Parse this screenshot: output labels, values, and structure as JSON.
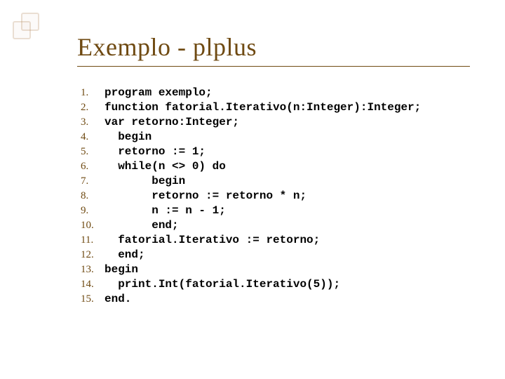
{
  "slide": {
    "title": "Exemplo - plplus"
  },
  "code": {
    "lines": [
      {
        "n": "1.",
        "text": "program exemplo;"
      },
      {
        "n": "2.",
        "text": "function fatorial.Iterativo(n:Integer):Integer;"
      },
      {
        "n": "3.",
        "text": "var retorno:Integer;"
      },
      {
        "n": "4.",
        "text": "  begin"
      },
      {
        "n": "5.",
        "text": "  retorno := 1;"
      },
      {
        "n": "6.",
        "text": "  while(n <> 0) do"
      },
      {
        "n": "7.",
        "text": "       begin"
      },
      {
        "n": "8.",
        "text": "       retorno := retorno * n;"
      },
      {
        "n": "9.",
        "text": "       n := n - 1;"
      },
      {
        "n": "10.",
        "text": "       end;"
      },
      {
        "n": "11.",
        "text": "  fatorial.Iterativo := retorno;"
      },
      {
        "n": "12.",
        "text": "  end;"
      },
      {
        "n": "13.",
        "text": "begin"
      },
      {
        "n": "14.",
        "text": "  print.Int(fatorial.Iterativo(5));"
      },
      {
        "n": "15.",
        "text": "end."
      }
    ]
  }
}
